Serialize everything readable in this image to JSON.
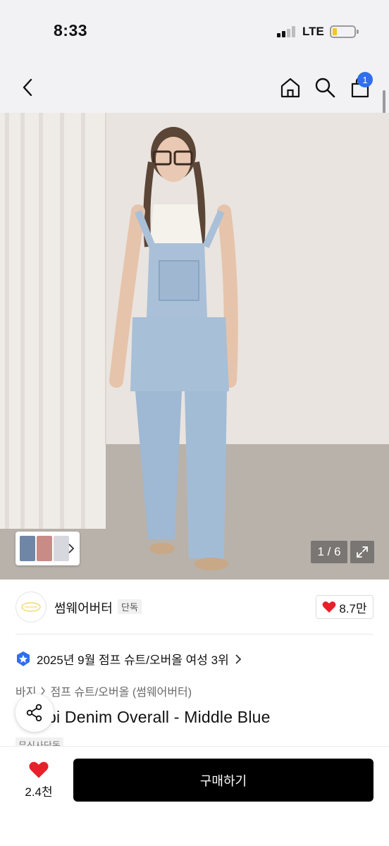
{
  "status_bar": {
    "time": "8:33",
    "network": "LTE"
  },
  "nav": {
    "cart_count": "1"
  },
  "image": {
    "counter": "1 / 6"
  },
  "brand": {
    "name": "썸웨어버터",
    "tag": "단독",
    "likes": "8.7만"
  },
  "ranking": {
    "text": "2025년 9월 점프 슈트/오버올 여성 3위"
  },
  "breadcrumb": {
    "category": "바지",
    "subcategory": "점프 슈트/오버올 (썸웨어버터)"
  },
  "product": {
    "name": "bi Denim Overall - Middle Blue",
    "partial_tag": "무신사단독"
  },
  "bottom": {
    "like_count": "2.4천",
    "buy_label": "구매하기"
  },
  "colors": {
    "accent_blue": "#2f6fed",
    "heart_red": "#e8202a",
    "buy_bg": "#000000"
  }
}
